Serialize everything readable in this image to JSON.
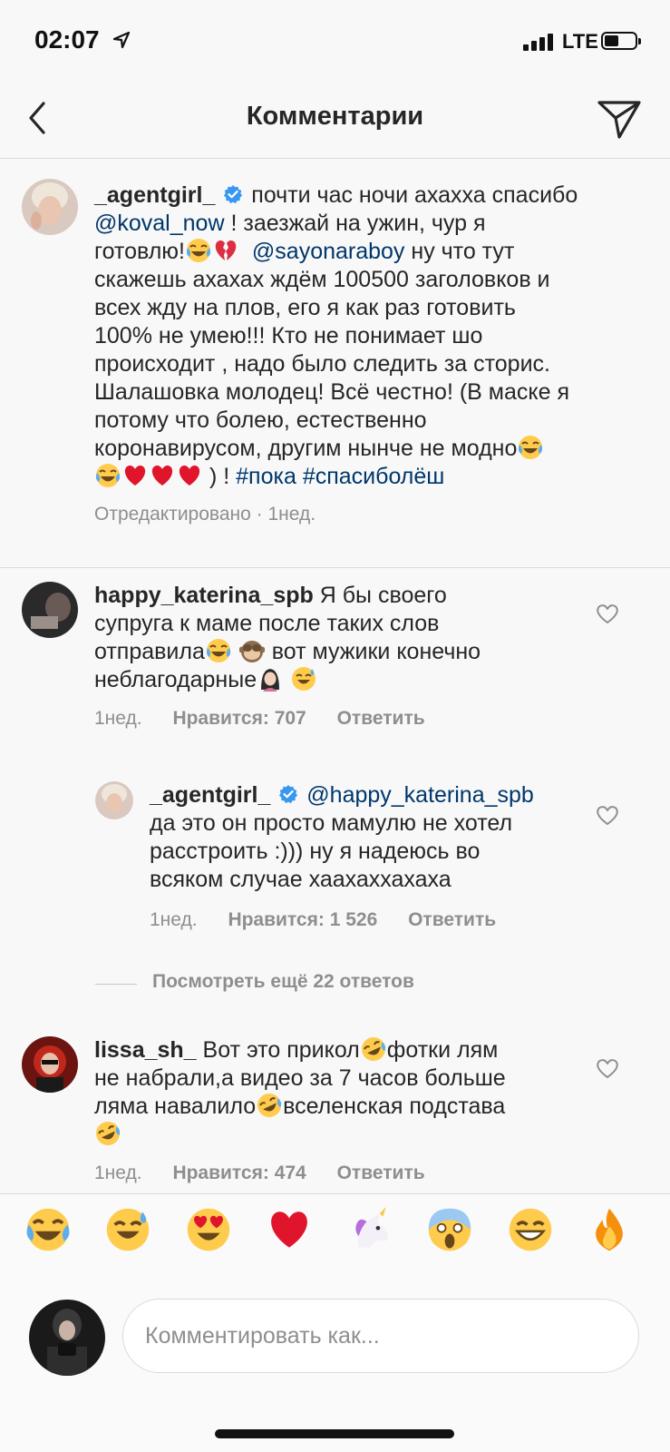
{
  "status_bar": {
    "time": "02:07",
    "network": "LTE",
    "icons": [
      "location-arrow-icon",
      "signal-bars-icon",
      "battery-icon"
    ]
  },
  "nav": {
    "title": "Комментарии",
    "back_icon": "chevron-left-icon",
    "share_icon": "paper-plane-icon"
  },
  "caption": {
    "username": "_agentgirl_",
    "text_1": "почти час ночи ахахха спасибо",
    "mention_1": "@koval_now",
    "text_2": "! заезжай на ужин, чур я",
    "text_3": "готовлю!",
    "mention_2": "@sayonaraboy",
    "text_4": "ну что тут",
    "text_5": "скажешь ахахах ждём 100500 заголовков и",
    "text_6": "всех жду на плов, его я как раз готовить",
    "text_7": "100% не умею!!! Кто не понимает шо",
    "text_8": "происходит , надо было следить за сторис.",
    "text_9": "Шалашовка молодец! Всё честно! (В маске я",
    "text_10": "потому что болею, естественно",
    "text_11": "коронавирусом, другим нынче не модно",
    "text_12": ") !",
    "hashtag_1": "#пока",
    "hashtag_2": "#спасиболёш",
    "meta": "Отредактировано · 1нед."
  },
  "comments": [
    {
      "username": "happy_katerina_spb",
      "line_1": "Я бы своего",
      "line_2": "супруга к маме после таких слов",
      "line_3a": "отправила",
      "line_3b": "вот мужики конечно",
      "line_4": "неблагодарные",
      "time": "1нед.",
      "likes": "Нравится: 707",
      "reply": "Ответить"
    },
    {
      "username": "_agentgirl_",
      "mention": "@happy_katerina_spb",
      "line_2": "да это он просто мамулю не хотел",
      "line_3": "расстроить :))) ну я надеюсь во",
      "line_4": "всяком случае хаахаххахаха",
      "time": "1нед.",
      "likes": "Нравится: 1 526",
      "reply": "Ответить"
    },
    {
      "username": "lissa_sh_",
      "line_1a": "Вот это прикол",
      "line_1b": "фотки лям",
      "line_2": "не набрали,а видео за 7 часов больше",
      "line_3a": "ляма навалило",
      "line_3b": "вселенская подстава",
      "time": "1нед.",
      "likes": "Нравится: 474",
      "reply": "Ответить"
    }
  ],
  "view_more": "Посмотреть ещё 22 ответов",
  "emoji_bar": [
    "😂",
    "😅",
    "😍",
    "❤️",
    "🦄",
    "😱",
    "😁",
    "🔥"
  ],
  "composer": {
    "placeholder": "Комментировать как..."
  },
  "colors": {
    "link": "#00376b",
    "verified": "#3897f0",
    "muted": "#8e8e8e",
    "heart_red": "#e0152b"
  }
}
